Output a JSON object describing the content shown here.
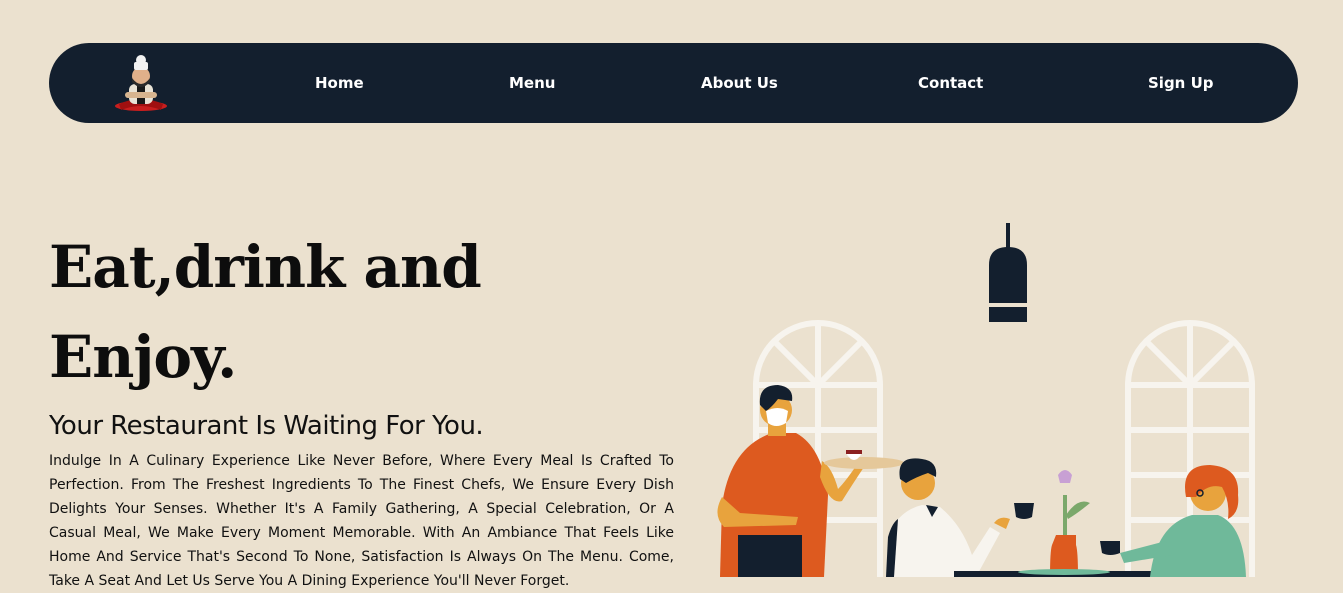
{
  "nav": {
    "logo_icon": "chef-mascot-icon",
    "links": [
      "Home",
      "Menu",
      "About Us",
      "Contact",
      "Sign Up"
    ]
  },
  "hero": {
    "title_line1": "Eat,drink and",
    "title_line2": "Enjoy.",
    "subtitle": "Your Restaurant Is Waiting For You.",
    "description": "Indulge In A Culinary Experience Like Never Before, Where Every Meal Is Crafted To Perfection. From The Freshest Ingredients To The Finest Chefs, We Ensure Every Dish Delights Your Senses. Whether It's A Family Gathering, A Special Celebration, Or A Casual Meal, We Make Every Moment Memorable. With An Ambiance That Feels Like Home And Service That's Second To None, Satisfaction Is Always On The Menu. Come, Take A Seat And Let Us Serve You A Dining Experience You'll Never Forget."
  },
  "illustration": {
    "icon": "restaurant-dining-illustration"
  },
  "colors": {
    "background": "#ebe1cf",
    "navbar": "#131f2e",
    "accent_orange": "#dd5a1f"
  }
}
